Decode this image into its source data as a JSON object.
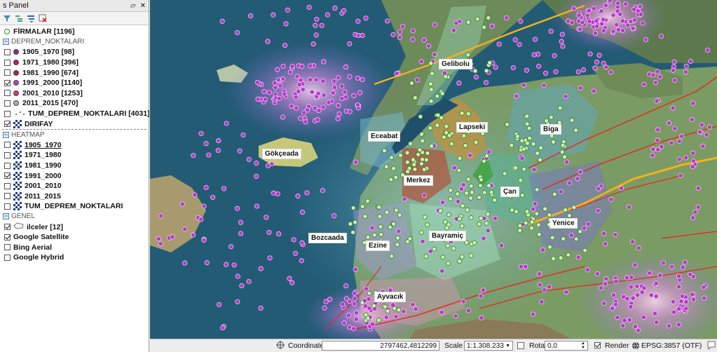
{
  "panel": {
    "title": "s Panel",
    "tree": [
      {
        "kind": "point-layer",
        "label": "FİRMALAR [1196]",
        "checked": true,
        "color": "#c8f7a6",
        "bold": true
      },
      {
        "kind": "group",
        "label": "DEPREM_NOKTALARI"
      },
      {
        "kind": "class",
        "label": "1905_1970 [98]",
        "checked": false,
        "color": "#8e2e80"
      },
      {
        "kind": "class",
        "label": "1971_1980 [396]",
        "checked": false,
        "color": "#c41d5a"
      },
      {
        "kind": "class",
        "label": "1981_1990 [674]",
        "checked": false,
        "color": "#b0213a"
      },
      {
        "kind": "class",
        "label": "1991_2000 [1140]",
        "checked": true,
        "color": "#b23fd4"
      },
      {
        "kind": "class",
        "label": "2001_2010 [1253]",
        "checked": false,
        "color": "#e8307a"
      },
      {
        "kind": "class",
        "label": "2011_2015 [470]",
        "checked": false,
        "color": "#9ab0d8"
      },
      {
        "kind": "plain",
        "label": "TUM_DEPREM_NOKTALARI [4031]",
        "checked": false
      },
      {
        "kind": "raster",
        "label": "DIRIFAY",
        "checked": true,
        "bold": true
      },
      {
        "kind": "group",
        "label": "HEATMAP",
        "dashed": true
      },
      {
        "kind": "raster",
        "label": "1905_1970",
        "checked": false,
        "underline": true
      },
      {
        "kind": "raster",
        "label": "1971_1980",
        "checked": false
      },
      {
        "kind": "raster",
        "label": "1981_1990",
        "checked": false
      },
      {
        "kind": "raster",
        "label": "1991_2000",
        "checked": true
      },
      {
        "kind": "raster",
        "label": "2001_2010",
        "checked": false
      },
      {
        "kind": "raster",
        "label": "2011_2015",
        "checked": false
      },
      {
        "kind": "raster",
        "label": "TUM_DEPREM_NOKTALARI",
        "checked": false
      },
      {
        "kind": "group",
        "label": "GENEL"
      },
      {
        "kind": "poly",
        "label": "ilceler [12]",
        "checked": true
      },
      {
        "kind": "plain",
        "label": "Google Satellite",
        "checked": true
      },
      {
        "kind": "plain",
        "label": "Bing Aerial",
        "checked": false
      },
      {
        "kind": "plain",
        "label": "Google Hybrid",
        "checked": false
      }
    ]
  },
  "map": {
    "places": [
      "Gelibolu",
      "Lapseki",
      "Biga",
      "Eceabat",
      "Gökçeada",
      "Merkez",
      "Çan",
      "Yenice",
      "Bozcaada",
      "Ezine",
      "Bayramiç",
      "Ayvacık"
    ],
    "colors": {
      "earthquake": "#b33cc8",
      "firm": "#c8f7a6",
      "fault": "#e8241c",
      "fault2": "#f2b01e"
    }
  },
  "status": {
    "coordinate_label": "Coordinate:",
    "coordinate_value": "2797462,4812299",
    "scale_label": "Scale",
    "scale_value": "1:1.308.233",
    "rotation_label": "Rotation:",
    "rotation_value": "0,0",
    "render_label": "Render",
    "render_checked": true,
    "crs_label": "EPSG:3857 (OTF)"
  }
}
